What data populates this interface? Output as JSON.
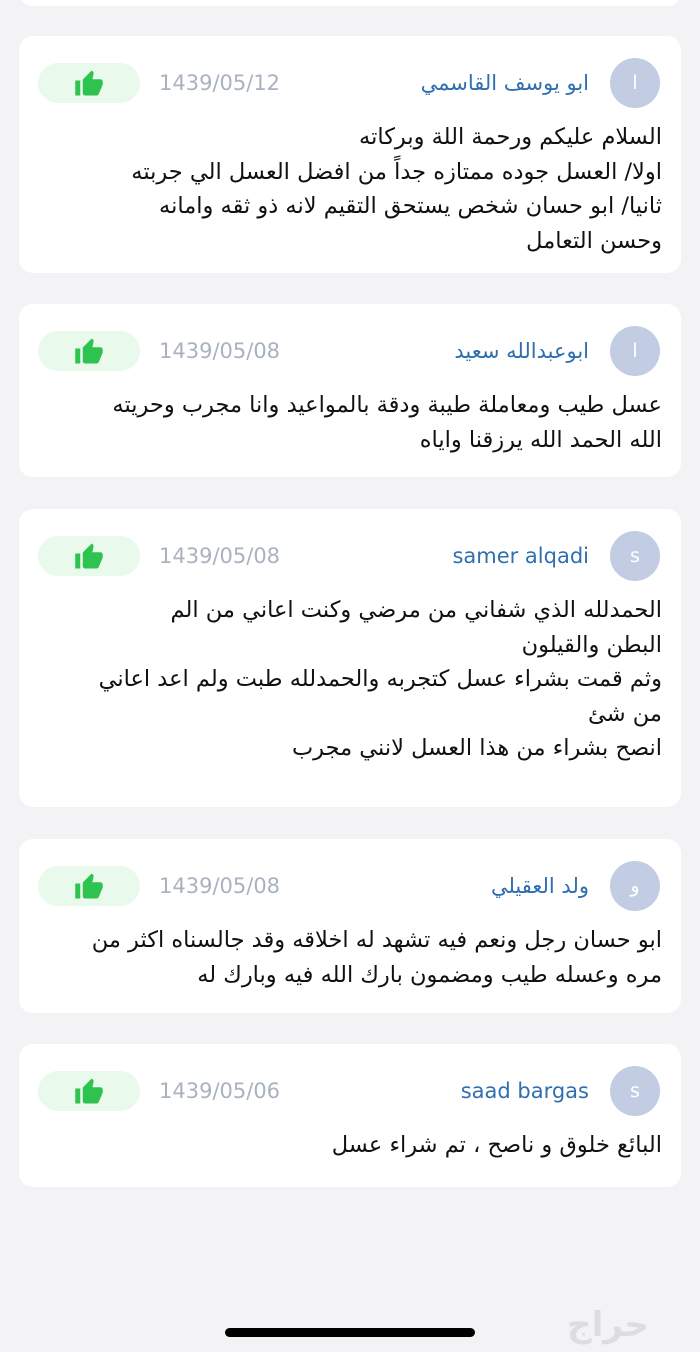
{
  "colors": {
    "accent_name": "#2f6fb0",
    "date_text": "#a9b2bf",
    "like_bg": "#e9f9ec",
    "like_icon": "#2ec24f",
    "avatar_bg": "#c2cde3",
    "page_bg": "#f3f3f6"
  },
  "like_icon_name": "thumbs-up-icon",
  "reviews": [
    {
      "avatar_letter": "ا",
      "name": "ابو يوسف القاسمي",
      "date": "1439/05/12",
      "text": "السلام عليكم ورحمة اللة وبركاته\nاولا/ العسل  جوده ممتازه جداً من افضل العسل الي جربته\nثانيا/ ابو حسان شخص يستحق التقيم لانه ذو ثقه وامانه\nوحسن التعامل"
    },
    {
      "avatar_letter": "ا",
      "name": "ابوعبدالله سعيد",
      "date": "1439/05/08",
      "text": "عسل طيب ومعاملة طيبة ودقة بالمواعيد وانا مجرب وحريته\nالله الحمد الله يرزقنا واياه"
    },
    {
      "avatar_letter": "s",
      "name": "samer alqadi",
      "date": "1439/05/08",
      "text": "الحمدلله الذي شفاني من مرضي وكنت اعاني من الم\nالبطن والقيلون\nوثم قمت بشراء عسل كتجربه والحمدلله طبت ولم اعد اعاني\nمن شئ\nانصح بشراء من هذا العسل لانني مجرب"
    },
    {
      "avatar_letter": "و",
      "name": "ولد العقيلي",
      "date": "1439/05/08",
      "text": "ابو حسان رجل ونعم فيه تشهد له اخلاقه وقد جالسناه اكثر من\nمره وعسله طيب ومضمون بارك الله فيه وبارك له"
    },
    {
      "avatar_letter": "s",
      "name": "saad bargas",
      "date": "1439/05/06",
      "text": "البائع خلوق و ناصح ، تم شراء عسل"
    }
  ],
  "watermark_text": "حراج"
}
